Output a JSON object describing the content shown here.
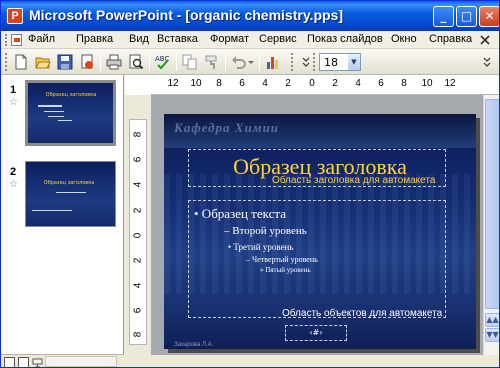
{
  "window": {
    "app_icon": "P",
    "title": "Microsoft PowerPoint - [organic chemistry.pps]",
    "controls": {
      "minimize": "_",
      "maximize": "□",
      "close": "✕"
    }
  },
  "menu": {
    "items": [
      "Файл",
      "Правка",
      "Вид",
      "Вставка",
      "Формат",
      "Сервис",
      "Показ слайдов",
      "Окно",
      "Справка"
    ],
    "help_input_placeholder": ""
  },
  "toolbar": {
    "icons": [
      "new-icon",
      "open-icon",
      "save-icon",
      "permission-icon",
      "print-icon",
      "print-preview-icon",
      "spelling-icon",
      "copy-icon",
      "format-painter-icon",
      "undo-icon",
      "insert-chart-icon"
    ],
    "font_size": "18"
  },
  "ruler": {
    "horizontal": [
      "12",
      "10",
      "8",
      "6",
      "4",
      "2",
      "0",
      "2",
      "4",
      "6",
      "8",
      "10",
      "12"
    ],
    "vertical": [
      "8",
      "6",
      "4",
      "2",
      "0",
      "2",
      "4",
      "6",
      "8"
    ]
  },
  "slides_pane": {
    "slides": [
      {
        "number": "1",
        "title": "Образец заголовка",
        "selected": true
      },
      {
        "number": "2",
        "title": "Образец заголовка",
        "selected": false
      }
    ]
  },
  "slide": {
    "header": "Кафедра Химии",
    "title": "Образец заголовка",
    "title_caption": "Область заголовка для автомакета",
    "levels": [
      "• Образец текста",
      "– Второй уровень",
      "• Третий уровень",
      "– Четвертый уровень",
      "» Пятый уровень"
    ],
    "body_caption": "Область объектов для автомакета",
    "number_placeholder": "‹#›",
    "footer_name": "Захарова Л.А."
  },
  "colors": {
    "title_bar": "#0A5CE0",
    "slide_background": "#142C72",
    "slide_title": "#FFD23F"
  }
}
